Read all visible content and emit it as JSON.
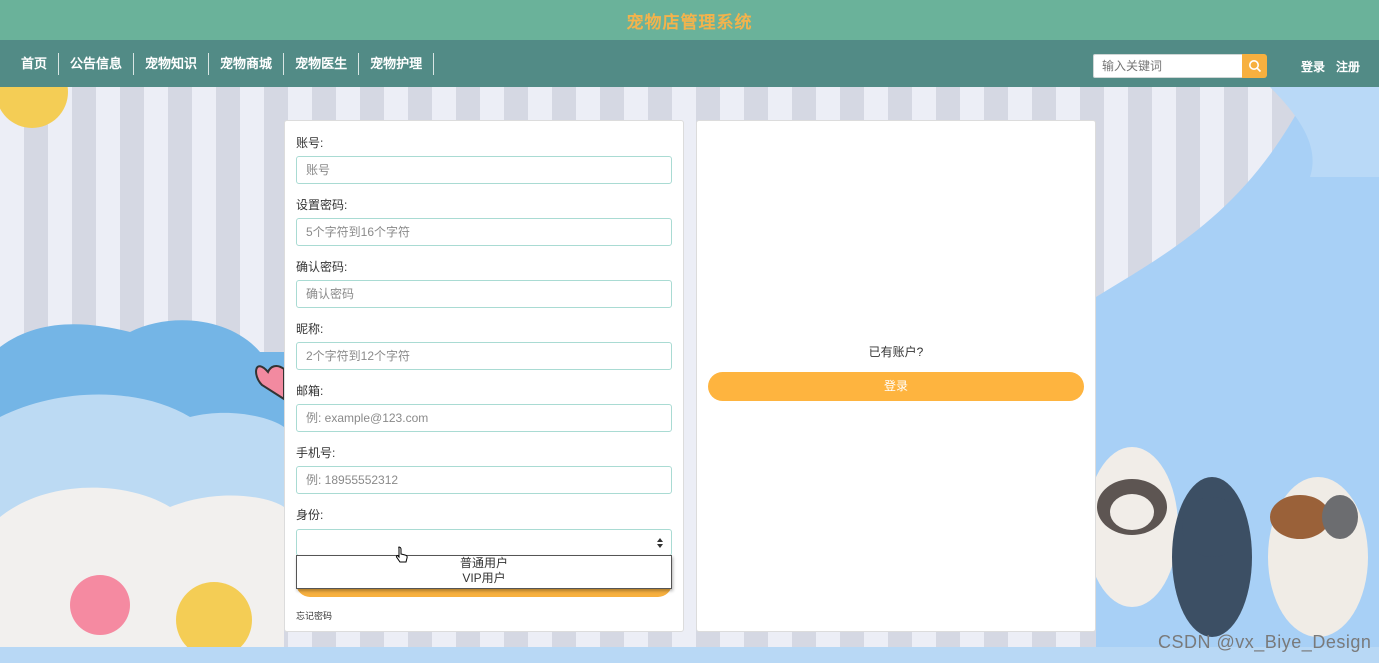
{
  "header": {
    "title": "宠物店管理系统"
  },
  "nav": {
    "items": [
      "首页",
      "公告信息",
      "宠物知识",
      "宠物商城",
      "宠物医生",
      "宠物护理"
    ],
    "search_placeholder": "输入关键词",
    "login": "登录",
    "register": "注册"
  },
  "form": {
    "account": {
      "label": "账号:",
      "placeholder": "账号"
    },
    "password": {
      "label": "设置密码:",
      "placeholder": "5个字符到16个字符"
    },
    "confirm": {
      "label": "确认密码:",
      "placeholder": "确认密码"
    },
    "nickname": {
      "label": "昵称:",
      "placeholder": "2个字符到12个字符"
    },
    "email": {
      "label": "邮箱:",
      "placeholder": "例: example@123.com"
    },
    "phone": {
      "label": "手机号:",
      "placeholder": "例: 18955552312"
    },
    "role": {
      "label": "身份:",
      "value": "",
      "options": [
        "普通用户",
        "VIP用户"
      ]
    },
    "forgot": "忘记密码"
  },
  "side": {
    "have_account": "已有账户?",
    "login_button": "登录"
  },
  "watermark": "CSDN @vx_Biye_Design",
  "colors": {
    "header": "#6ab29a",
    "nav": "#528b86",
    "accent": "#f7b03f",
    "title_text": "#f3b34c"
  }
}
